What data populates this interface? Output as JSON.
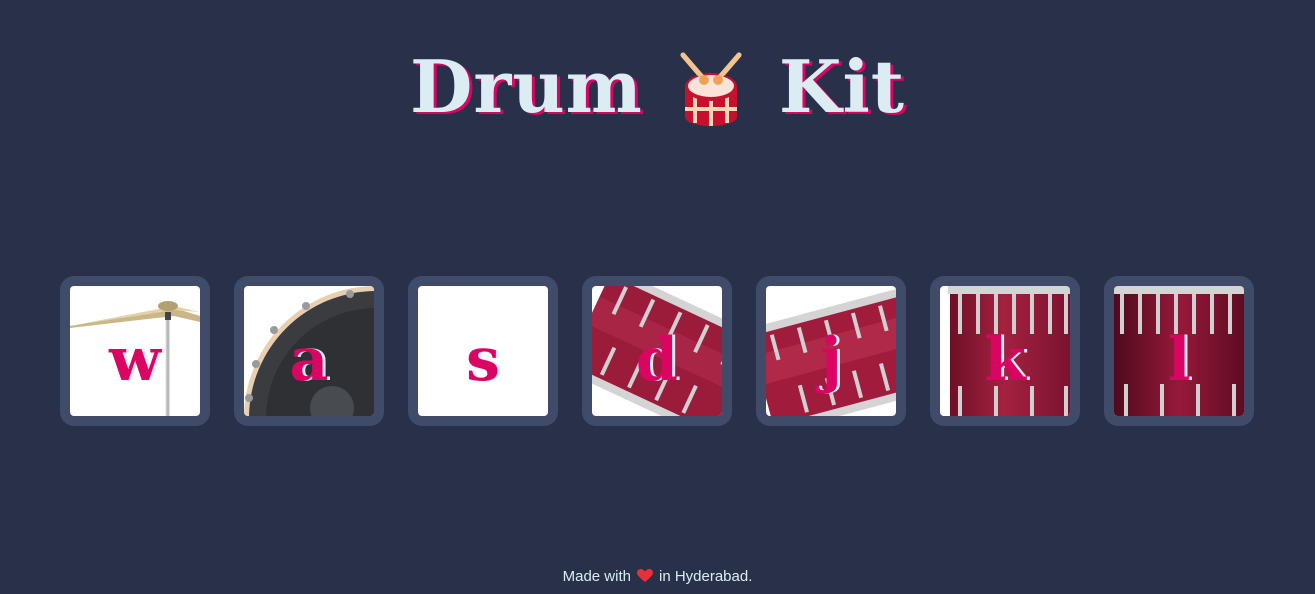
{
  "title": {
    "word_left": "Drum",
    "word_right": "Kit",
    "emoji_icon": "drum-with-drumsticks"
  },
  "pads": [
    {
      "key": "w",
      "instrument_icon": "crash-cymbal"
    },
    {
      "key": "a",
      "instrument_icon": "kick-drum"
    },
    {
      "key": "s",
      "instrument_icon": "snare-drum"
    },
    {
      "key": "d",
      "instrument_icon": "tom-1"
    },
    {
      "key": "j",
      "instrument_icon": "tom-2"
    },
    {
      "key": "k",
      "instrument_icon": "tom-3"
    },
    {
      "key": "l",
      "instrument_icon": "tom-4"
    }
  ],
  "footer": {
    "text_before": "Made with",
    "heart_icon": "red-heart",
    "text_after": "in Hyderabad."
  },
  "colors": {
    "background": "#283149",
    "pad_frame": "#404B69",
    "accent": "#DA0463",
    "light": "#DBEDF3",
    "drum_red": "#9B1B3A"
  }
}
